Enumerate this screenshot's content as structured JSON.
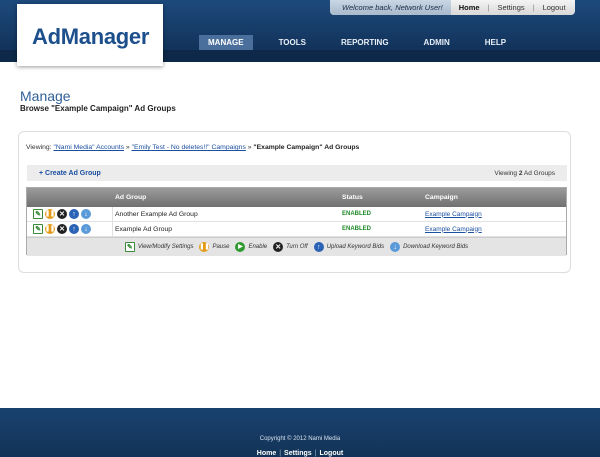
{
  "brand": {
    "logo_text": "AdManager",
    "primary_color": "#1c4f8c"
  },
  "topbar": {
    "welcome": "Welcome back, Network User!",
    "links": [
      "Home",
      "Settings",
      "Logout"
    ]
  },
  "nav": {
    "items": [
      "MANAGE",
      "TOOLS",
      "REPORTING",
      "ADMIN",
      "HELP"
    ],
    "active": "MANAGE"
  },
  "page": {
    "title": "Manage",
    "subtitle": "Browse \"Example Campaign\" Ad Groups"
  },
  "breadcrumb": {
    "prefix": "Viewing:",
    "items": [
      "\"Nami Media\" Accounts",
      "\"Emily Test - No deletes!!\" Campaigns",
      "\"Example Campaign\" Ad Groups"
    ],
    "separator": "»"
  },
  "actions": {
    "create": "+ Create Ad Group",
    "viewing_prefix": "Viewing",
    "viewing_count": "2",
    "viewing_suffix": "Ad Groups"
  },
  "table": {
    "headers": [
      "Ad Group",
      "Status",
      "Campaign"
    ],
    "rows": [
      {
        "name": "Another Example Ad Group",
        "status": "ENABLED",
        "campaign": "Example Campaign"
      },
      {
        "name": "Example Ad Group",
        "status": "ENABLED",
        "campaign": "Example Campaign"
      }
    ]
  },
  "legend": [
    "View/Modify Settings",
    "Pause",
    "Enable",
    "Turn Off",
    "Upload Keyword Bids",
    "Download Keyword Bids"
  ],
  "footer": {
    "copyright": "Copyright © 2012 Nami Media",
    "links": [
      "Home",
      "Settings",
      "Logout"
    ]
  }
}
